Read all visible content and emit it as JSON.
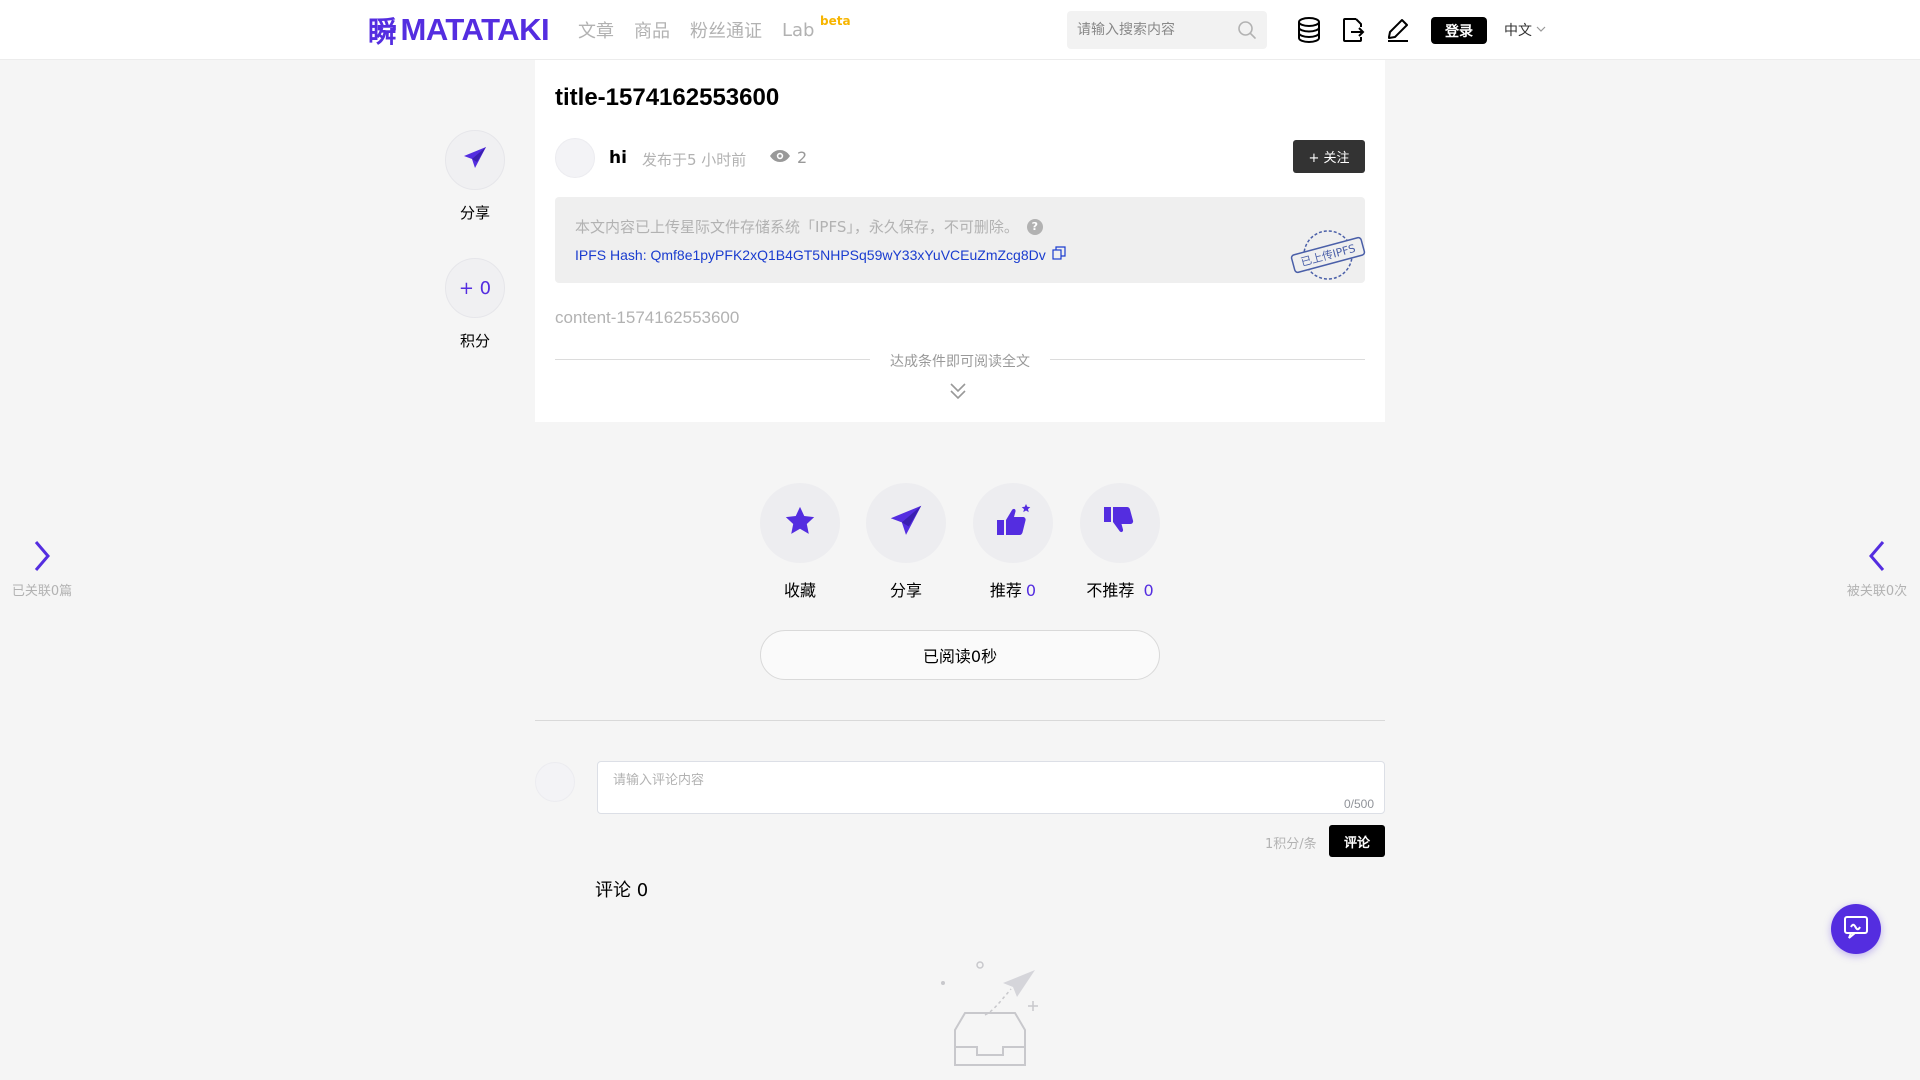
{
  "brand": {
    "logo_mark": "瞬",
    "logo_text": "MATATAKI",
    "color": "#542de0"
  },
  "nav": {
    "items": [
      "文章",
      "商品",
      "粉丝通证"
    ],
    "lab": "Lab",
    "lab_badge": "beta"
  },
  "search": {
    "placeholder": "请输入搜索内容"
  },
  "header_icons": [
    "database-icon",
    "export-icon",
    "edit-icon"
  ],
  "header": {
    "login_label": "登录",
    "language": "中文"
  },
  "side_actions": {
    "share_label": "分享",
    "points_value": "+ 0",
    "points_label": "积分"
  },
  "article": {
    "title": "title-1574162553600",
    "author": "hi",
    "published": "发布于5 小时前",
    "views": "2",
    "follow_label": "+ 关注",
    "ipfs_note": "本文内容已上传星际文件存储系统「IPFS」，永久保存，不可删除。",
    "ipfs_hash": "IPFS Hash: Qmf8e1pyPFK2xQ1B4GT5NHPSq59wY33xYuVCEuZmZcg8Dv",
    "ipfs_stamp": "已上传IPFS",
    "content": "content-1574162553600",
    "unlock_hint": "达成条件即可阅读全文"
  },
  "reactions": [
    {
      "icon": "star-icon",
      "label": "收藏",
      "count": ""
    },
    {
      "icon": "paper-plane-icon",
      "label": "分享",
      "count": ""
    },
    {
      "icon": "thumbs-up-icon",
      "label": "推荐",
      "count": "0"
    },
    {
      "icon": "thumbs-down-icon",
      "label": "不推荐",
      "count": "0"
    }
  ],
  "read_time": "已阅读0秒",
  "comments": {
    "placeholder": "请输入评论内容",
    "counter": "0/500",
    "cost": "1积分/条",
    "submit_label": "评论",
    "title": "评论 0"
  },
  "side_nav": {
    "left_label": "已关联0篇",
    "right_label": "被关联0次"
  }
}
